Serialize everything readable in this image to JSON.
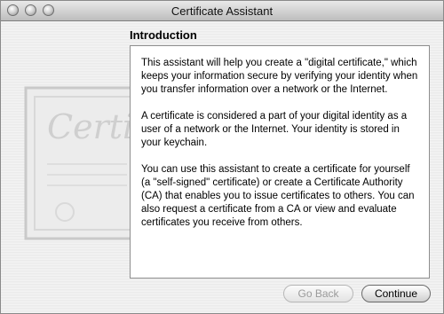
{
  "window": {
    "title": "Certificate Assistant"
  },
  "page": {
    "heading": "Introduction",
    "paragraphs": [
      "This assistant will help you create a \"digital certificate,\" which keeps your information secure by verifying your identity when you transfer information over a network or the Internet.",
      "A certificate is considered a part of your digital identity as a user of a network or the Internet. Your identity is stored in your keychain.",
      "You can use this assistant to create a certificate for yourself (a \"self-signed\" certificate) or create a Certificate Authority (CA) that enables you to issue certificates to others. You can also request a certificate from a CA or view and evaluate certificates you receive from others."
    ]
  },
  "artwork": {
    "script_text": "Certif"
  },
  "buttons": {
    "back": "Go Back",
    "continue": "Continue"
  }
}
